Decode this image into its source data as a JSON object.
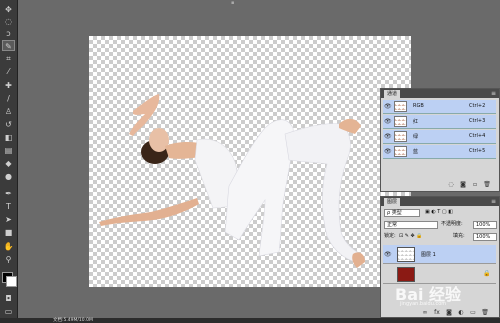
{
  "app": {
    "top_marker": "▪"
  },
  "status_bar": {
    "zoom": "",
    "doc_info": "文档:5.49M/10.0M"
  },
  "channels_panel": {
    "tab": "通道",
    "channels": [
      {
        "name": "RGB",
        "shortcut": "Ctrl+2"
      },
      {
        "name": "红",
        "shortcut": "Ctrl+3"
      },
      {
        "name": "绿",
        "shortcut": "Ctrl+4"
      },
      {
        "name": "蓝",
        "shortcut": "Ctrl+5"
      }
    ]
  },
  "layers_panel": {
    "tab": "图层",
    "kind_filter": "ρ 类型",
    "blend_mode": "正常",
    "opacity_label": "不透明度:",
    "opacity_value": "100%",
    "lock_label": "锁定:",
    "fill_label": "填充:",
    "fill_value": "100%",
    "layers": [
      {
        "name": "图层 1",
        "active": true
      },
      {
        "name": "",
        "active": false
      }
    ]
  },
  "watermark": {
    "text": "Bai 经验",
    "sub": "jingyan.baidu.com"
  },
  "colors": {
    "selection": "#bcd0f3",
    "panel": "#d6d6d6",
    "toolbar": "#3b3b3b"
  }
}
